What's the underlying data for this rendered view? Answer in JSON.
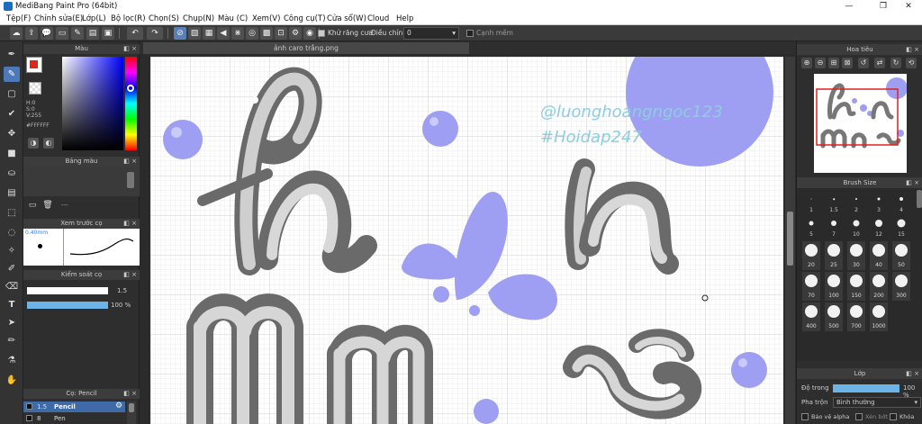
{
  "window": {
    "title": "MediBang Paint Pro (64bit)",
    "minimize": "—",
    "maximize": "❐",
    "close": "✕"
  },
  "menu": [
    "Tệp(F)",
    "Chỉnh sửa(E)",
    "Lớp(L)",
    "Bộ lọc(R)",
    "Chọn(S)",
    "Chụp(N)",
    "Màu (C)",
    "Xem(V)",
    "Công cụ(T)",
    "Cửa sổ(W)",
    "Cloud",
    "Help"
  ],
  "toolbar": {
    "antialias_label": "Khử răng cưa",
    "correction_label": "Điều chỉnh",
    "correction_value": "0",
    "snap_label": "Cạnh mềm"
  },
  "color_panel": {
    "title": "Màu",
    "h": "H:0",
    "s": "S:0",
    "v": "V:255",
    "hex": "#FFFFFF"
  },
  "palette_panel": {
    "title": "Bảng màu",
    "more": "---"
  },
  "brush_preview": {
    "title": "Xem trước cọ",
    "size": "0.40mm"
  },
  "brush_control": {
    "title": "Kiểm soát cọ",
    "size_value": "1.5",
    "opacity_value": "100 %"
  },
  "brush_list": {
    "title": "Cọ: Pencil",
    "items": [
      {
        "size": "1.5",
        "name": "Pencil"
      },
      {
        "size": "8",
        "name": "Pen"
      }
    ]
  },
  "canvas": {
    "tab": "ảnh caro trắng.png",
    "watermark1": "@luonghoangngoc123",
    "watermark2": "#Hoidap247"
  },
  "navigator": {
    "title": "Hoa tiêu"
  },
  "brush_size": {
    "title": "Brush Size",
    "small": [
      "1",
      "1.5",
      "2",
      "3",
      "4",
      "5",
      "7",
      "10",
      "12",
      "15"
    ],
    "big": [
      "20",
      "25",
      "30",
      "40",
      "50",
      "70",
      "100",
      "150",
      "200",
      "300",
      "400",
      "500",
      "700",
      "1000"
    ]
  },
  "layer": {
    "title": "Lớp",
    "opacity_label": "Độ trong",
    "opacity_value": "100 %",
    "blend_label": "Pha trộn",
    "blend_value": "Bình thường",
    "protect_alpha": "Bảo vệ alpha",
    "clip": "Xén bớt",
    "lock": "Khóa"
  },
  "colors": {
    "accent": "#4d79b8",
    "bubble": "#9e9ef2",
    "canvas": "#ffffff",
    "watermark": "#8ecde0"
  },
  "icons": [
    "pen-icon",
    "eraser-icon",
    "rect-select-icon",
    "check-icon",
    "move-icon",
    "fill-rect-icon",
    "bucket-icon",
    "gradient-icon",
    "lasso-icon",
    "magic-wand-icon",
    "select-pen-icon",
    "text-icon",
    "operation-icon",
    "eyedropper-icon",
    "hand-icon"
  ]
}
